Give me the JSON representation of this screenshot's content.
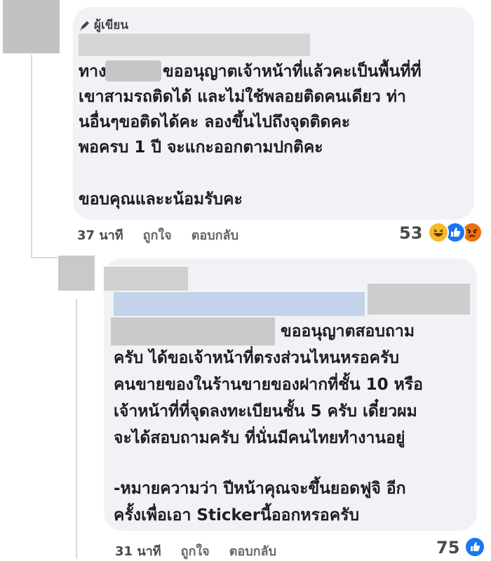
{
  "comment1": {
    "author_badge": "ผู้เขียน",
    "lines": [
      "ทาง",
      "ขออนุญาตเจ้าหน้าที่แล้วคะเป็นพื้นที่ที่",
      "เขาสามรถติดได้ และไม่ใช้พลอยติดคนเดียว ท่า",
      "นอื่นๆขอติดได้คะ ลองขึ้นไปถึงจุดติดคะ",
      "พอครบ 1 ปี จะแกะออกตามปกติคะ",
      "ขอบคุณและะน้อมรับคะ"
    ],
    "age": "37 นาที",
    "like_label": "ถูกใจ",
    "reply_label": "ตอบกลับ",
    "reaction_count": "53",
    "reaction_icons": [
      "haha-icon",
      "like-icon",
      "angry-icon"
    ]
  },
  "comment2": {
    "lines": [
      "ขออนุญาตสอบถาม",
      "ครับ ได้ขอเจ้าหน้าที่ตรงส่วนไหนหรอครับ",
      "คนขายของในร้านขายของฝากที่ชั้น 10 หรือ",
      "เจ้าหน้าที่ที่จุดลงทะเบียนชั้น 5 ครับ เดี๋ยวผม",
      "จะได้สอบถามครับ ที่นั่นมีคนไทยทำงานอยู่",
      "-หมายความว่า ปีหน้าคุณจะขึ้นยอดฟูจิ อีก",
      "ครั้งเพื่อเอา Stickerนี้ออกหรอครับ"
    ],
    "age": "31 นาที",
    "like_label": "ถูกใจ",
    "reply_label": "ตอบกลับ",
    "reaction_count": "75",
    "reaction_icons": [
      "like-icon"
    ]
  },
  "colors": {
    "bubble": "#f0f2f5",
    "meta_text": "#65676b",
    "like_blue": "#1877f2",
    "haha_yellow": "#f7b928",
    "angry_red": "#e9710f"
  }
}
